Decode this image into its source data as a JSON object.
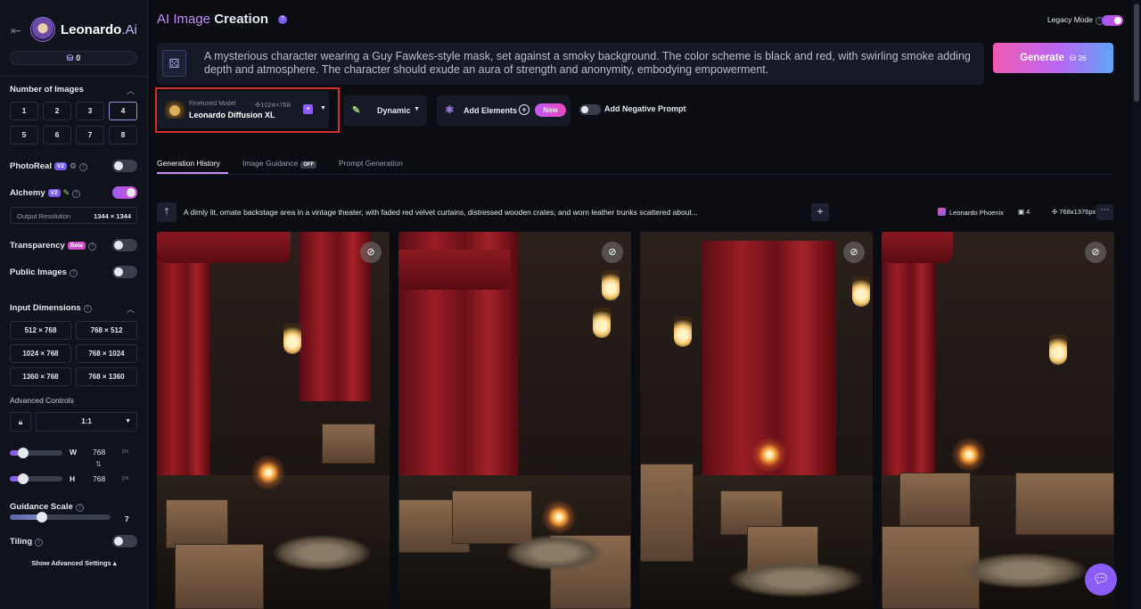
{
  "sidebar": {
    "logo": {
      "name": "Leonardo",
      "suffix": ".Ai"
    },
    "tokens": "0",
    "number_of_images": {
      "title": "Number of Images",
      "options": [
        "1",
        "2",
        "3",
        "4",
        "5",
        "6",
        "7",
        "8"
      ],
      "selected": "4"
    },
    "photoreal": {
      "label": "PhotoReal",
      "badge": "V2",
      "enabled": false
    },
    "alchemy": {
      "label": "Alchemy",
      "badge": "V2",
      "enabled": true
    },
    "output_resolution": {
      "label": "Output Resolution",
      "value": "1344 × 1344"
    },
    "transparency": {
      "label": "Transparency",
      "badge": "Beta",
      "enabled": false
    },
    "public_images": {
      "label": "Public Images",
      "enabled": false
    },
    "input_dimensions": {
      "title": "Input Dimensions",
      "options": [
        "512 × 768",
        "768 × 512",
        "1024 × 768",
        "768 × 1024",
        "1360 × 768",
        "768 × 1360"
      ]
    },
    "advanced_controls": {
      "label": "Advanced Controls",
      "ratio": "1:1"
    },
    "width": {
      "label": "W",
      "value": "768",
      "unit": "px",
      "slider_fraction": 0.25
    },
    "height": {
      "label": "H",
      "value": "768",
      "unit": "px",
      "slider_fraction": 0.25
    },
    "guidance_scale": {
      "label": "Guidance Scale",
      "value": "7"
    },
    "tiling": {
      "label": "Tiling",
      "enabled": false
    },
    "show_advanced": "Show Advanced Settings"
  },
  "header": {
    "title_highlight": "AI Image",
    "title_rest": " Creation",
    "legacy_mode": {
      "label": "Legacy Mode",
      "enabled": true
    }
  },
  "prompt": {
    "text": "A mysterious character wearing a Guy Fawkes-style mask, set against a smoky background. The color scheme is black and red, with swirling smoke adding depth and atmosphere. The character should exude an aura of strength and anonymity, embodying empowerment."
  },
  "generate": {
    "label": "Generate",
    "cost": "26"
  },
  "model": {
    "type_label": "Finetuned Model",
    "resolution": "1024×768",
    "name": "Leonardo Diffusion XL"
  },
  "style": {
    "label": "Dynamic"
  },
  "elements": {
    "label": "Add Elements",
    "badge": "New"
  },
  "negative_prompt": {
    "label": "Add Negative Prompt",
    "enabled": false
  },
  "tabs": [
    {
      "label": "Generation History",
      "active": true
    },
    {
      "label": "Image Guidance",
      "badge": "OFF",
      "active": false
    },
    {
      "label": "Prompt Generation",
      "active": false
    }
  ],
  "generation": {
    "prompt": "A dimly lit, ornate backstage area in a vintage theater, with faded red velvet curtains, distressed wooden crates, and worn leather trunks scattered about...",
    "model": "Leonardo Phoenix",
    "count": "4",
    "size": "768x1376px"
  },
  "colors": {
    "accent": "#c18ff5",
    "brand": "#8b5cf6",
    "highlight_border": "#d0302d"
  },
  "icons": [
    "back-arrow-icon",
    "token-icon",
    "dice-icon",
    "help-icon",
    "eye-off-icon",
    "up-arrow-icon",
    "plus-icon",
    "more-icon",
    "chat-icon",
    "lock-icon",
    "swap-icon",
    "atom-icon",
    "brush-icon"
  ]
}
